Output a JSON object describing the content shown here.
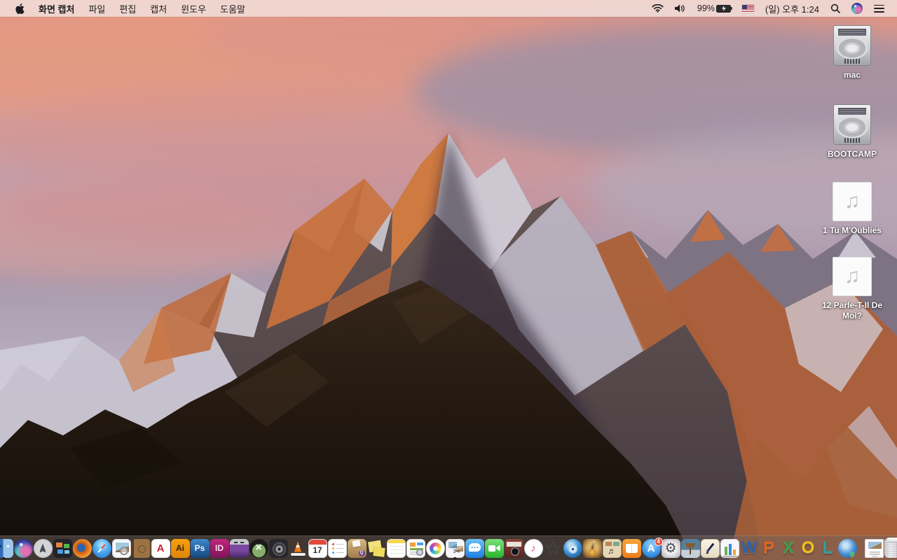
{
  "theme": {
    "menubar_bg": "rgba(240,218,213,0.92)",
    "menubar_fg": "#1d1d1f",
    "dock_bg": "rgba(110,98,94,0.5)",
    "desktop_label_color": "#ffffff",
    "badge_color": "#e94b35",
    "wallpaper_sky_top": "#e09180",
    "wallpaper_sunlit_rock": "#c9713d",
    "wallpaper_shadow_rock": "#2a2028"
  },
  "menubar": {
    "app_name": "화면 캡처",
    "menus": [
      "파일",
      "편집",
      "캡처",
      "윈도우",
      "도움말"
    ],
    "status": {
      "battery_percent": "99%",
      "clock": "(일) 오후 1:24",
      "icons": [
        "wifi-icon",
        "volume-icon",
        "battery-charging-icon",
        "us-flag-input-source-icon",
        "spotlight-search-icon",
        "siri-icon",
        "notification-center-icon"
      ]
    }
  },
  "desktop": {
    "icons": [
      {
        "name": "mac-drive-icon",
        "cls": "icon-drive d-mac",
        "label": "mac"
      },
      {
        "name": "bootcamp-drive-icon",
        "cls": "icon-drive",
        "label": "BOOTCAMP"
      },
      {
        "name": "music-file-icon-1",
        "cls": "icon-music",
        "label": "1 Tu M'Oublies"
      },
      {
        "name": "music-file-icon-2",
        "cls": "icon-music",
        "label": "12 Parle-T-Il De Moi?"
      }
    ]
  },
  "dock": {
    "apps": [
      {
        "name": "finder-dock-icon",
        "cls": "ic-finder",
        "wrap": "running"
      },
      {
        "name": "siri-dock-icon",
        "cls": "ic-siri"
      },
      {
        "name": "launchpad-dock-icon",
        "cls": "ic-launchpad"
      },
      {
        "name": "mission-control-dock-icon",
        "cls": "ic-mission"
      },
      {
        "name": "firefox-dock-icon",
        "cls": "ic-firefox"
      },
      {
        "name": "safari-dock-icon",
        "cls": "ic-safari"
      },
      {
        "name": "preview-dock-icon",
        "cls": "ic-preview"
      },
      {
        "name": "journal-book-dock-icon",
        "cls": "ic-book"
      },
      {
        "name": "acrobat-reader-dock-icon",
        "cls": "ic-acrobat",
        "glyph": "A"
      },
      {
        "name": "illustrator-dock-icon",
        "cls": "ic-ai",
        "glyph": "Ai"
      },
      {
        "name": "photoshop-dock-icon",
        "cls": "ic-ps",
        "glyph": "Ps"
      },
      {
        "name": "indesign-dock-icon",
        "cls": "ic-id",
        "glyph": "ID"
      },
      {
        "name": "toast-dock-icon",
        "cls": "ic-toast"
      },
      {
        "name": "image-viewer-dock-icon",
        "cls": "ic-xee",
        "glyph": "×"
      },
      {
        "name": "film-reel-dock-icon",
        "cls": "ic-reel"
      },
      {
        "name": "vlc-dock-icon",
        "cls": "ic-vlc"
      },
      {
        "name": "calendar-dock-icon",
        "cls": "ic-cal",
        "glyph": "17"
      },
      {
        "name": "reminders-dock-icon",
        "cls": "ic-rem"
      },
      {
        "name": "drop-box-dock-icon",
        "cls": "ic-dropbox"
      },
      {
        "name": "stickies-dock-icon",
        "cls": "ic-stickies"
      },
      {
        "name": "notes-dock-icon",
        "cls": "ic-notes"
      },
      {
        "name": "layout-doc-dock-icon",
        "cls": "ic-layout"
      },
      {
        "name": "photos-dock-icon",
        "cls": "ic-photos"
      },
      {
        "name": "grab-screen-capture-dock-icon",
        "cls": "ic-grab",
        "glyph": "✂",
        "wrap": "running"
      },
      {
        "name": "messages-dock-icon",
        "cls": "ic-messages"
      },
      {
        "name": "facetime-dock-icon",
        "cls": "ic-facetime"
      },
      {
        "name": "photo-booth-dock-icon",
        "cls": "ic-photobooth"
      },
      {
        "name": "itunes-dock-icon",
        "cls": "ic-itunes",
        "glyph": "♪"
      },
      {
        "name": "imovie-dock-icon",
        "cls": "ic-imovie",
        "glyph": "★"
      },
      {
        "name": "dvd-player-dock-icon",
        "cls": "ic-dvd"
      },
      {
        "name": "garageband-dock-icon",
        "cls": "ic-garage"
      },
      {
        "name": "sheet-music-dock-icon",
        "cls": "ic-sheet",
        "glyph": "♬"
      },
      {
        "name": "ibooks-dock-icon",
        "cls": "ic-ibooks"
      },
      {
        "name": "app-store-dock-icon",
        "cls": "ic-appstore",
        "glyph": "A",
        "badge": "4"
      },
      {
        "name": "system-preferences-dock-icon",
        "cls": "ic-sysprefs",
        "glyph": "⚙"
      },
      {
        "name": "keynote-dock-icon",
        "cls": "ic-keynote"
      },
      {
        "name": "pages-dock-icon",
        "cls": "ic-pages"
      },
      {
        "name": "numbers-dock-icon",
        "cls": "ic-numbers"
      },
      {
        "name": "word-dock-icon",
        "cls": "ic-letter l-word",
        "glyph": "W"
      },
      {
        "name": "powerpoint-dock-icon",
        "cls": "ic-letter l-ppt",
        "glyph": "P"
      },
      {
        "name": "excel-dock-icon",
        "cls": "ic-letter l-xl",
        "glyph": "X"
      },
      {
        "name": "outlook-dock-icon",
        "cls": "ic-letter l-ol",
        "glyph": "O"
      },
      {
        "name": "lync-dock-icon",
        "cls": "ic-letter l-lync",
        "glyph": "L"
      },
      {
        "name": "download-globe-dock-icon",
        "cls": "ic-globe"
      }
    ],
    "extras": [
      {
        "name": "document-dock-icon",
        "cls": "ic-doc"
      },
      {
        "name": "trash-dock-icon",
        "cls": "ic-trash"
      }
    ]
  }
}
